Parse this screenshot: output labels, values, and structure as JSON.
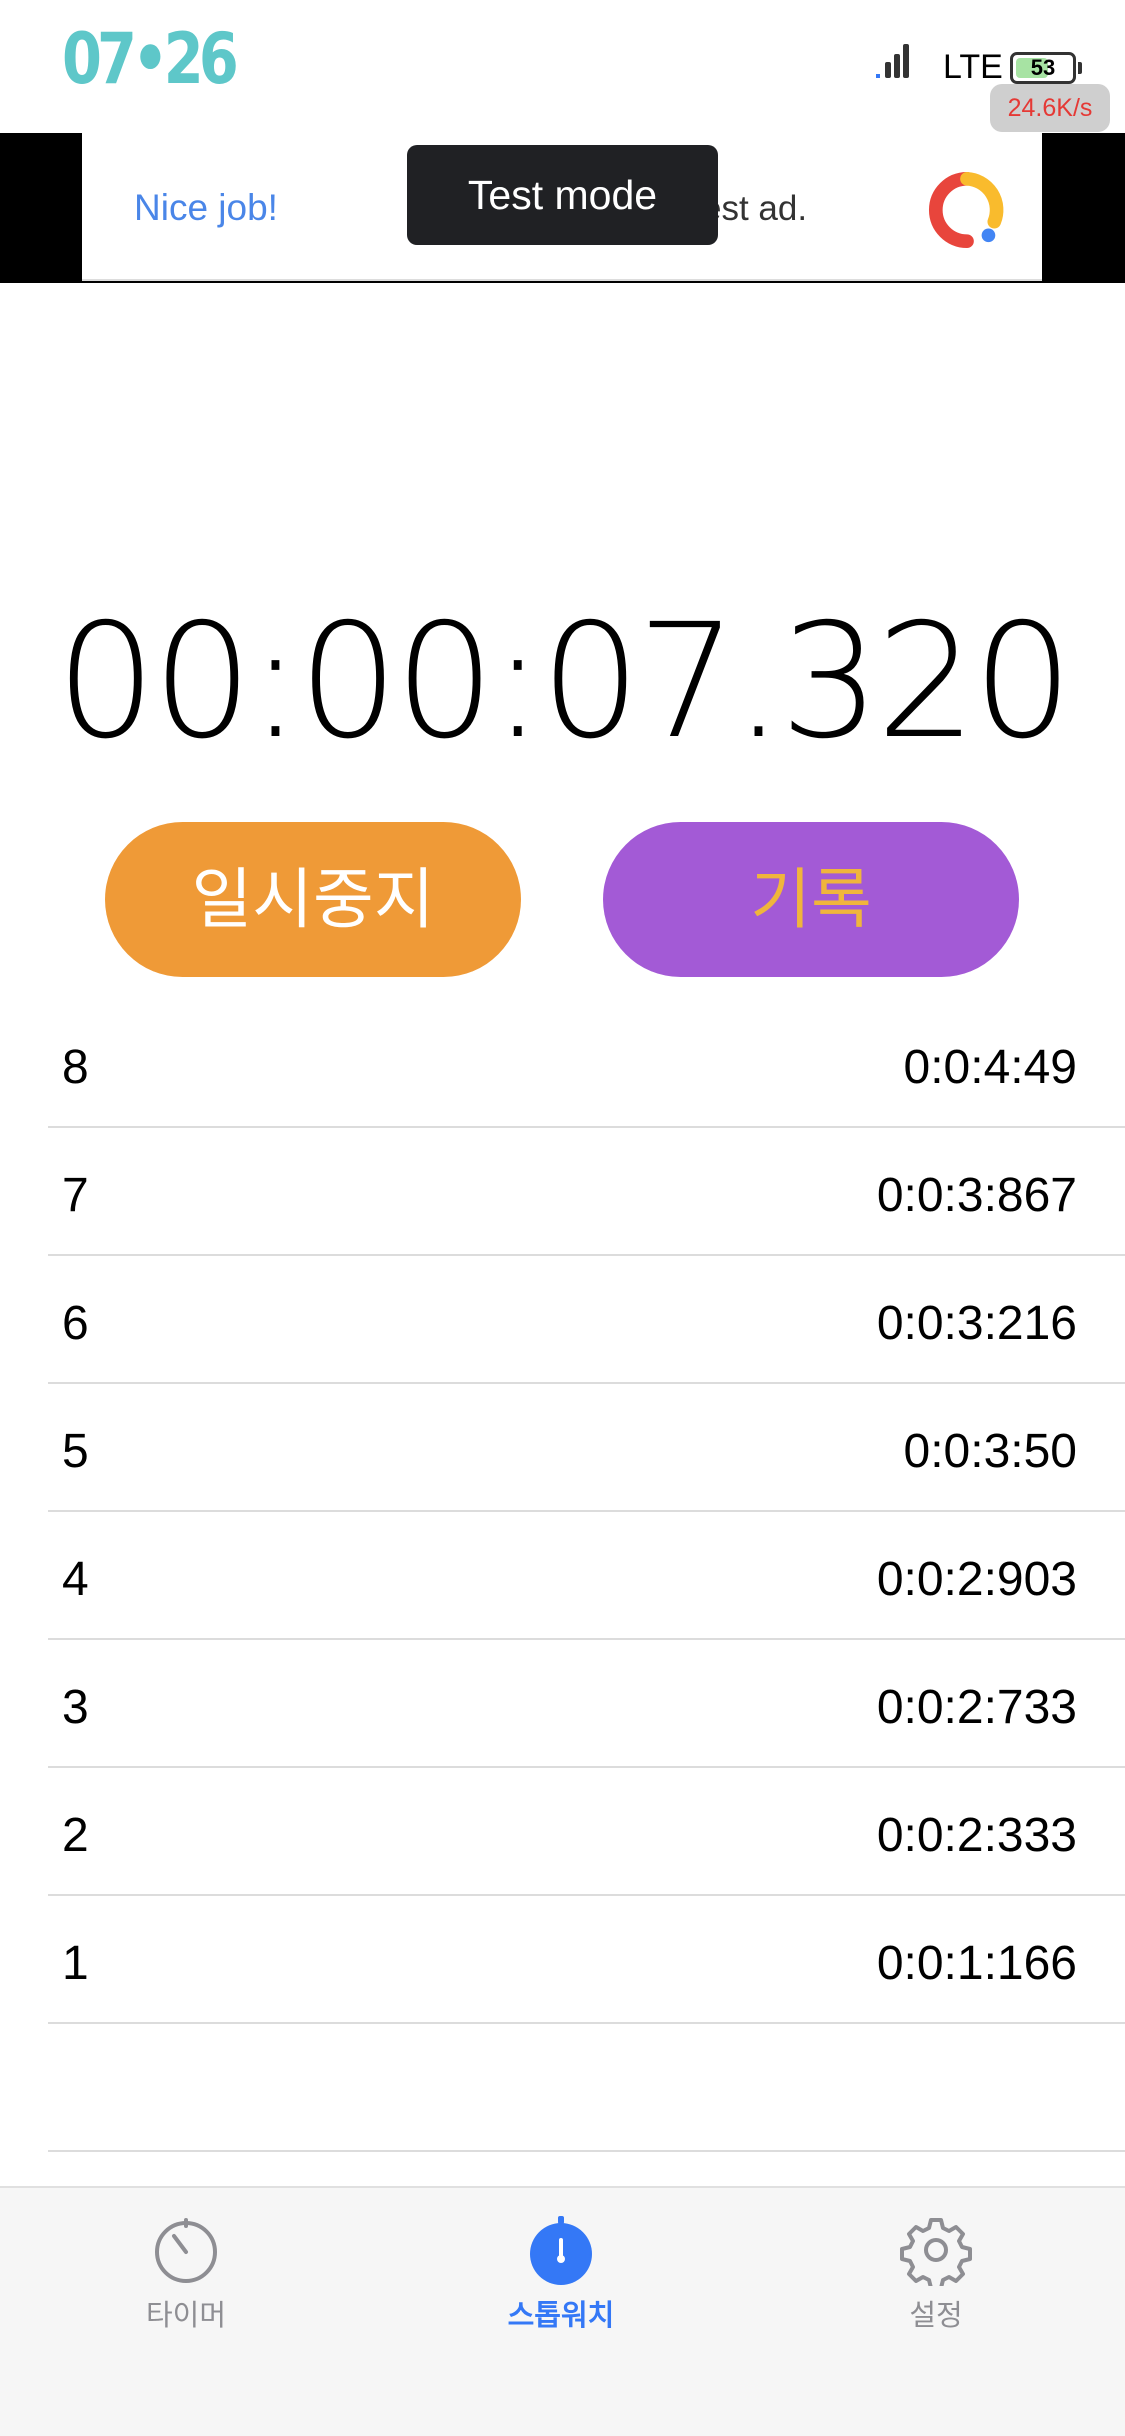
{
  "status_bar": {
    "time": "07•26",
    "network": "LTE",
    "battery": "53",
    "battery_level": 0.53,
    "speed": "24.6K/s"
  },
  "ad": {
    "nice_text": "Nice job!",
    "test_text": "est ad.",
    "toast": "Test mode",
    "logo_icon": "google-ads-logo"
  },
  "stopwatch": {
    "time": "00:00:07.320",
    "pause_label": "일시중지",
    "lap_label": "기록"
  },
  "laps": [
    {
      "num": "8",
      "time": "0:0:4:49"
    },
    {
      "num": "7",
      "time": "0:0:3:867"
    },
    {
      "num": "6",
      "time": "0:0:3:216"
    },
    {
      "num": "5",
      "time": "0:0:3:50"
    },
    {
      "num": "4",
      "time": "0:0:2:903"
    },
    {
      "num": "3",
      "time": "0:0:2:733"
    },
    {
      "num": "2",
      "time": "0:0:2:333"
    },
    {
      "num": "1",
      "time": "0:0:1:166"
    }
  ],
  "tabs": [
    {
      "label": "타이머",
      "icon": "timer-icon",
      "active": false
    },
    {
      "label": "스톱워치",
      "icon": "stopwatch-icon",
      "active": true
    },
    {
      "label": "설정",
      "icon": "gear-icon",
      "active": false
    }
  ],
  "colors": {
    "pause_button": "#ef9a37",
    "lap_button": "#a35ad6",
    "lap_button_text": "#f0b53c",
    "active_tab": "#3478f6",
    "inactive_tab": "#8e8e93",
    "clock": "#5ec7c9"
  }
}
